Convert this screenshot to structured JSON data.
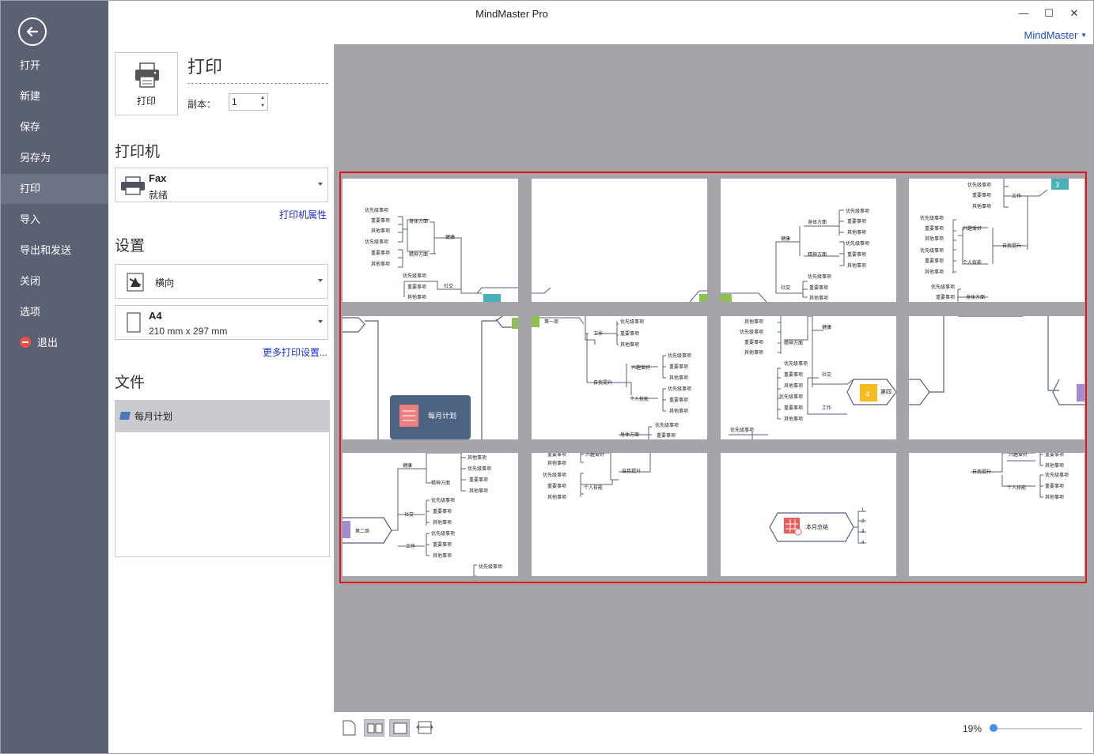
{
  "window": {
    "title": "MindMaster Pro",
    "brand": "MindMaster",
    "minimize": "—",
    "maximize": "☐",
    "close": "✕"
  },
  "sidebar": {
    "items": [
      {
        "label": "打开"
      },
      {
        "label": "新建"
      },
      {
        "label": "保存"
      },
      {
        "label": "另存为"
      },
      {
        "label": "打印",
        "active": true
      },
      {
        "label": "导入"
      },
      {
        "label": "导出和发送"
      },
      {
        "label": "关闭"
      },
      {
        "label": "选项"
      },
      {
        "label": "退出"
      }
    ]
  },
  "print": {
    "button_label": "打印",
    "title": "打印",
    "copies_label": "副本：",
    "copies_value": "1"
  },
  "printer": {
    "section_title": "打印机",
    "name": "Fax",
    "status": "就绪",
    "properties_link": "打印机属性"
  },
  "settings": {
    "section_title": "设置",
    "orientation": "横向",
    "paper_name": "A4",
    "paper_size": "210 mm x 297 mm",
    "more_link": "更多打印设置..."
  },
  "files": {
    "section_title": "文件",
    "items": [
      {
        "label": "每月计划"
      }
    ]
  },
  "preview": {
    "central_topic": "每月计划",
    "summary_topic": "本月总结",
    "weeks": [
      "第一周",
      "第二周",
      "3",
      "4",
      "第四"
    ],
    "labels": {
      "a": "优先级事项",
      "b": "重要事项",
      "c": "其他事项",
      "health": "健康",
      "body": "身体方面",
      "mind": "精神方面",
      "social": "社交",
      "work": "工作",
      "self": "自我提升",
      "hobby": "兴趣爱好",
      "skill": "个人技能"
    },
    "numbers": [
      "1",
      "2",
      "3",
      "4"
    ],
    "accent_colors": {
      "frame": "#e01515",
      "central": "#4d6383",
      "green": "#8cc152",
      "teal": "#48b1b6",
      "yellow": "#f6bb1d",
      "purple": "#a38cd0",
      "red": "#e95c5c"
    }
  },
  "bottom": {
    "zoom": "19%"
  }
}
